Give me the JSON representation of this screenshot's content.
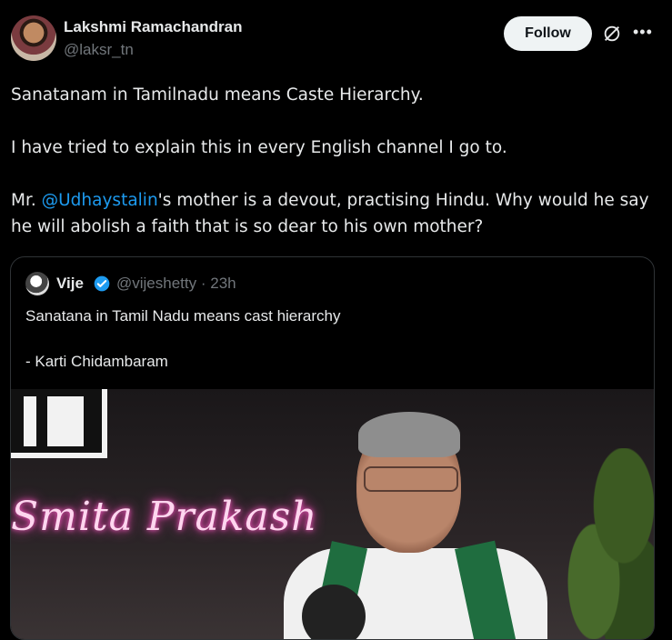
{
  "author": {
    "name": "Lakshmi Ramachandran",
    "handle": "@laksr_tn",
    "avatar_icon": "user-avatar"
  },
  "actions": {
    "follow_label": "Follow",
    "grok_icon": "grok-icon",
    "more_icon": "more-icon"
  },
  "tweet": {
    "line1": "Sanatanam in Tamilnadu means Caste Hierarchy.",
    "line2": "I have tried to explain this in every English channel I go to.",
    "line3_prefix": "Mr. ",
    "mention": "@Udhaystalin",
    "line3_suffix": "'s mother is a devout, practising Hindu. Why would he say he will abolish a faith that is so dear to his own mother?"
  },
  "quote": {
    "name": "Vije",
    "handle": "@vijeshetty",
    "time": "· 23h",
    "text_line1": "Sanatana in Tamil Nadu means cast hierarchy",
    "text_line2": "- Karti Chidambaram",
    "media": {
      "logo_text": "NI",
      "neon_text": "Smita Prakash"
    }
  },
  "colors": {
    "background": "#000000",
    "text": "#e7e9ea",
    "muted": "#71767b",
    "accent": "#1d9bf0",
    "border": "#2f3336"
  }
}
